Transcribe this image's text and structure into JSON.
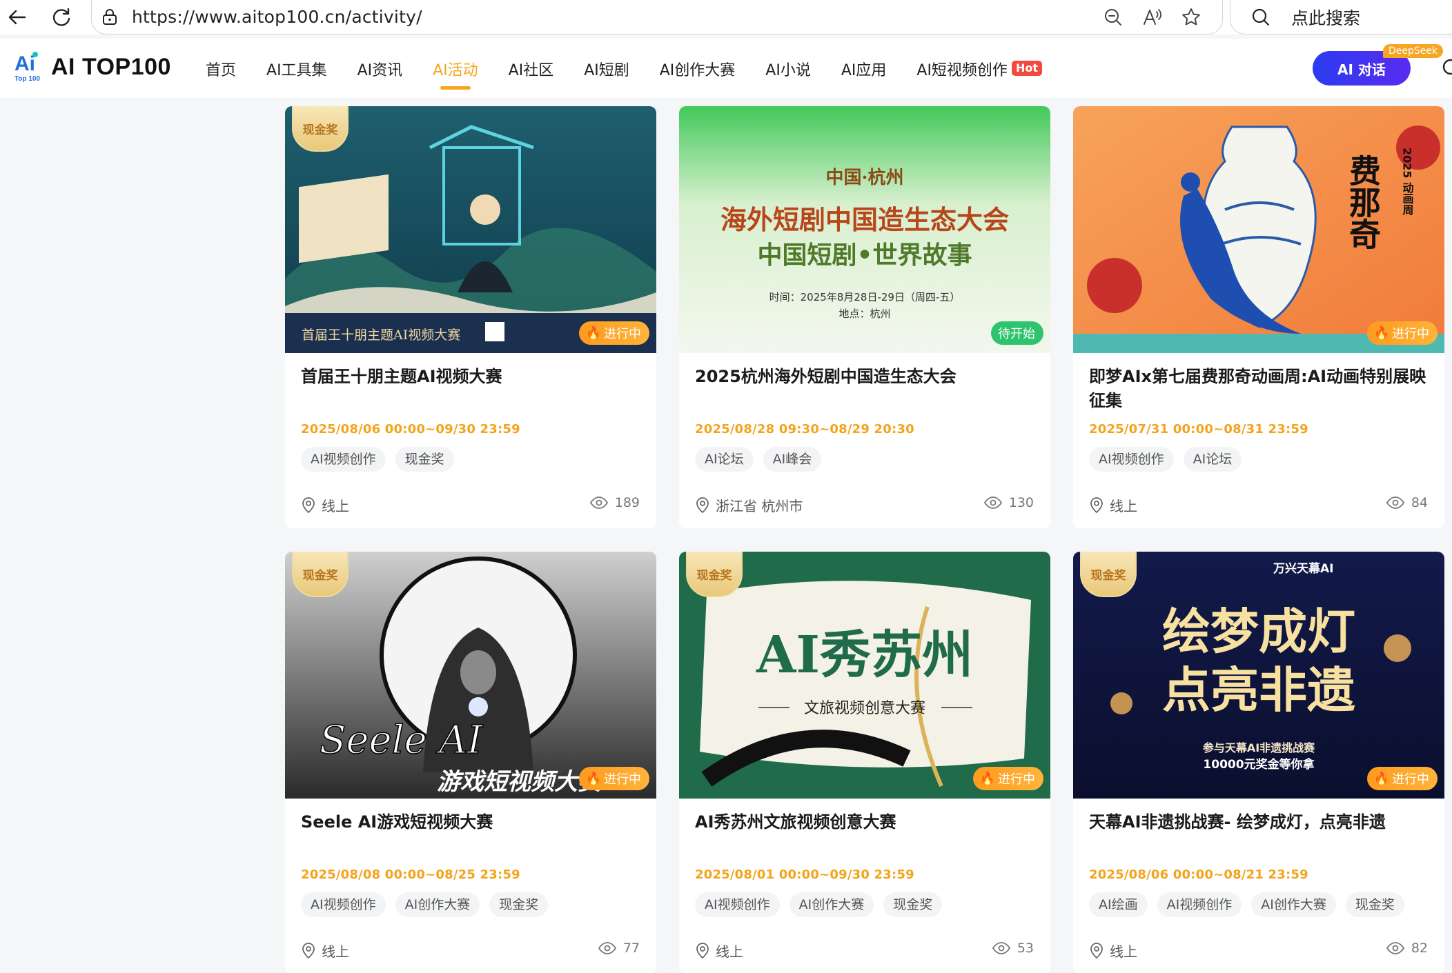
{
  "browser": {
    "url": "https://www.aitop100.cn/activity/",
    "search_placeholder": "点此搜索"
  },
  "header": {
    "logo_text": "AI TOP100",
    "logo_small": "Top 100",
    "nav": [
      {
        "label": "首页",
        "active": false
      },
      {
        "label": "AI工具集",
        "active": false
      },
      {
        "label": "AI资讯",
        "active": false
      },
      {
        "label": "AI活动",
        "active": true
      },
      {
        "label": "AI社区",
        "active": false
      },
      {
        "label": "AI短剧",
        "active": false
      },
      {
        "label": "AI创作大赛",
        "active": false
      },
      {
        "label": "AI小说",
        "active": false
      },
      {
        "label": "AI应用",
        "active": false
      },
      {
        "label": "AI短视频创作",
        "active": false
      }
    ],
    "hot_badge": "Hot",
    "chat_button": "AI 对话",
    "deepseek_tag": "DeepSeek",
    "accent_color": "#f5a623"
  },
  "cards": [
    {
      "cash": "现金奖",
      "status": "进行中",
      "status_type": "ongoing",
      "title": "首届王十朋主题AI视频大赛",
      "date": "2025/08/06 00:00~09/30 23:59",
      "tags": [
        "AI视频创作",
        "现金奖"
      ],
      "location": "线上",
      "views": "189",
      "cover_text": "首届王十朋主题AI视频大赛"
    },
    {
      "cash": "",
      "status": "待开始",
      "status_type": "pending",
      "title": "2025杭州海外短剧中国造生态大会",
      "date": "2025/08/28 09:30~08/29 20:30",
      "tags": [
        "AI论坛",
        "AI峰会"
      ],
      "location": "浙江省 杭州市",
      "views": "130",
      "cover_line1": "中国·杭州",
      "cover_line2": "海外短剧中国造生态大会",
      "cover_line3": "中国短剧•世界故事",
      "cover_line4": "时间：2025年8月28日-29日（周四-五）",
      "cover_line5": "地点：杭州"
    },
    {
      "cash": "",
      "status": "进行中",
      "status_type": "ongoing",
      "title": "即梦AIx第七届费那奇动画周:AI动画特别展映征集",
      "date": "2025/07/31 00:00~08/31 23:59",
      "tags": [
        "AI视频创作",
        "AI论坛"
      ],
      "location": "线上",
      "views": "84",
      "cover_text": "费那奇",
      "cover_sub": "2025 动画周"
    },
    {
      "cash": "现金奖",
      "status": "进行中",
      "status_type": "ongoing",
      "title": "Seele AI游戏短视频大赛",
      "date": "2025/08/08 00:00~08/25 23:59",
      "tags": [
        "AI视频创作",
        "AI创作大赛",
        "现金奖"
      ],
      "location": "线上",
      "views": "77",
      "cover_text": "Seele AI",
      "cover_sub": "游戏短视频大赛"
    },
    {
      "cash": "现金奖",
      "status": "进行中",
      "status_type": "ongoing",
      "title": "AI秀苏州文旅视频创意大赛",
      "date": "2025/08/01 00:00~09/30 23:59",
      "tags": [
        "AI视频创作",
        "AI创作大赛",
        "现金奖"
      ],
      "location": "线上",
      "views": "53",
      "cover_text": "AI秀苏州",
      "cover_sub": "文旅视频创意大赛"
    },
    {
      "cash": "现金奖",
      "status": "进行中",
      "status_type": "ongoing",
      "title": "天幕AI非遗挑战赛- 绘梦成灯，点亮非遗",
      "date": "2025/08/06 00:00~08/21 23:59",
      "tags": [
        "AI绘画",
        "AI视频创作",
        "AI创作大赛",
        "现金奖"
      ],
      "location": "线上",
      "views": "82",
      "cover_line1": "绘梦成灯",
      "cover_line2": "点亮非遗",
      "cover_line3": "参与天幕AI非遗挑战赛",
      "cover_line4": "10000元奖金等你拿",
      "cover_brand": "万兴天幕AI"
    }
  ]
}
